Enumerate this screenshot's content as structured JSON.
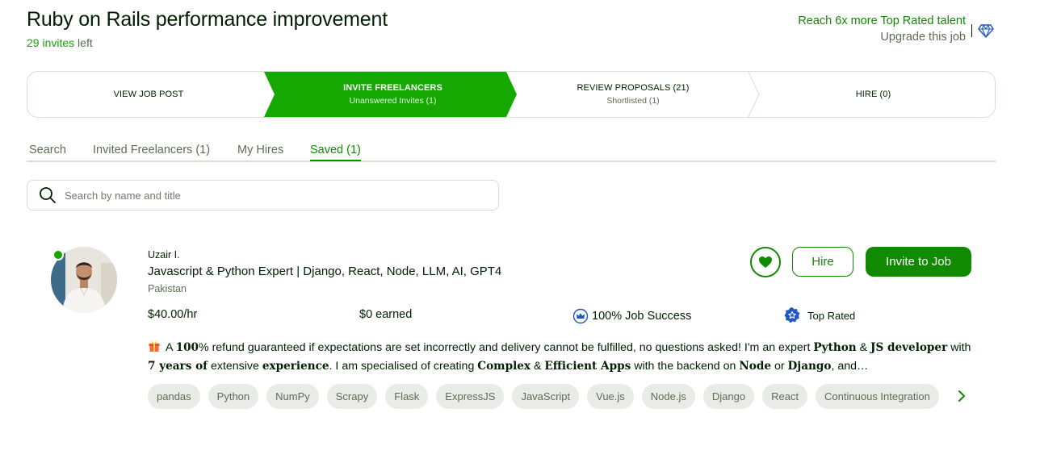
{
  "job": {
    "title": "Ruby on Rails performance improvement",
    "invites_count": "29 invites",
    "invites_suffix": " left"
  },
  "upgrade": {
    "reach_text": "Reach 6x more Top Rated talent",
    "upgrade_text": "Upgrade this job",
    "icon": "diamond-icon"
  },
  "steps": [
    {
      "label": "VIEW JOB POST",
      "sub": ""
    },
    {
      "label": "INVITE FREELANCERS",
      "sub": "Unanswered Invites (1)"
    },
    {
      "label": "REVIEW PROPOSALS (21)",
      "sub": "Shortlisted (1)"
    },
    {
      "label": "HIRE (0)",
      "sub": ""
    }
  ],
  "tabs": [
    {
      "label": "Search"
    },
    {
      "label": "Invited Freelancers (1)"
    },
    {
      "label": "My Hires"
    },
    {
      "label": "Saved (1)"
    }
  ],
  "active_tab": "Saved (1)",
  "search": {
    "placeholder": "Search by name and title",
    "icon": "search-icon"
  },
  "freelancer": {
    "name": "Uzair I.",
    "headline": "Javascript & Python Expert | Django, React, Node, LLM, AI, GPT4",
    "country": "Pakistan",
    "rate": "$40.00/hr",
    "earned": "$0 earned",
    "job_success": "100% Job Success",
    "badge": "Top Rated",
    "online": true,
    "description_parts": [
      {
        "t": "A ",
        "b": false
      },
      {
        "t": "100",
        "b": true
      },
      {
        "t": "% refund guaranteed if expectations are set incorrectly and delivery cannot be fulfilled, no questions asked! I'm an expert ",
        "b": false
      },
      {
        "t": "Python",
        "b": true
      },
      {
        "t": " & ",
        "b": false
      },
      {
        "t": "JS developer",
        "b": true
      },
      {
        "t": " with ",
        "b": false
      },
      {
        "t": "7 years of",
        "b": true
      },
      {
        "t": " extensive ",
        "b": false
      },
      {
        "t": "experience",
        "b": true
      },
      {
        "t": ". I am specialised of creating ",
        "b": false
      },
      {
        "t": "Complex",
        "b": true
      },
      {
        "t": " & ",
        "b": false
      },
      {
        "t": "Efficient Apps",
        "b": true
      },
      {
        "t": " with the backend on ",
        "b": false
      },
      {
        "t": "Node",
        "b": true
      },
      {
        "t": " or ",
        "b": false
      },
      {
        "t": "Django",
        "b": true
      },
      {
        "t": ", and…",
        "b": false
      }
    ],
    "skills": [
      "pandas",
      "Python",
      "NumPy",
      "Scrapy",
      "Flask",
      "ExpressJS",
      "JavaScript",
      "Vue.js",
      "Node.js",
      "Django",
      "React",
      "Continuous Integration"
    ]
  },
  "actions": {
    "save_icon": "heart-icon",
    "hire_label": "Hire",
    "invite_label": "Invite to Job"
  },
  "colors": {
    "brand_green": "#108a00",
    "active_step": "#14a800",
    "text": "#001e00",
    "muted": "#5e6d55",
    "border": "#d5e0d5",
    "chip_bg": "#e9ebe7",
    "top_rated_badge": "#1f57c3"
  }
}
